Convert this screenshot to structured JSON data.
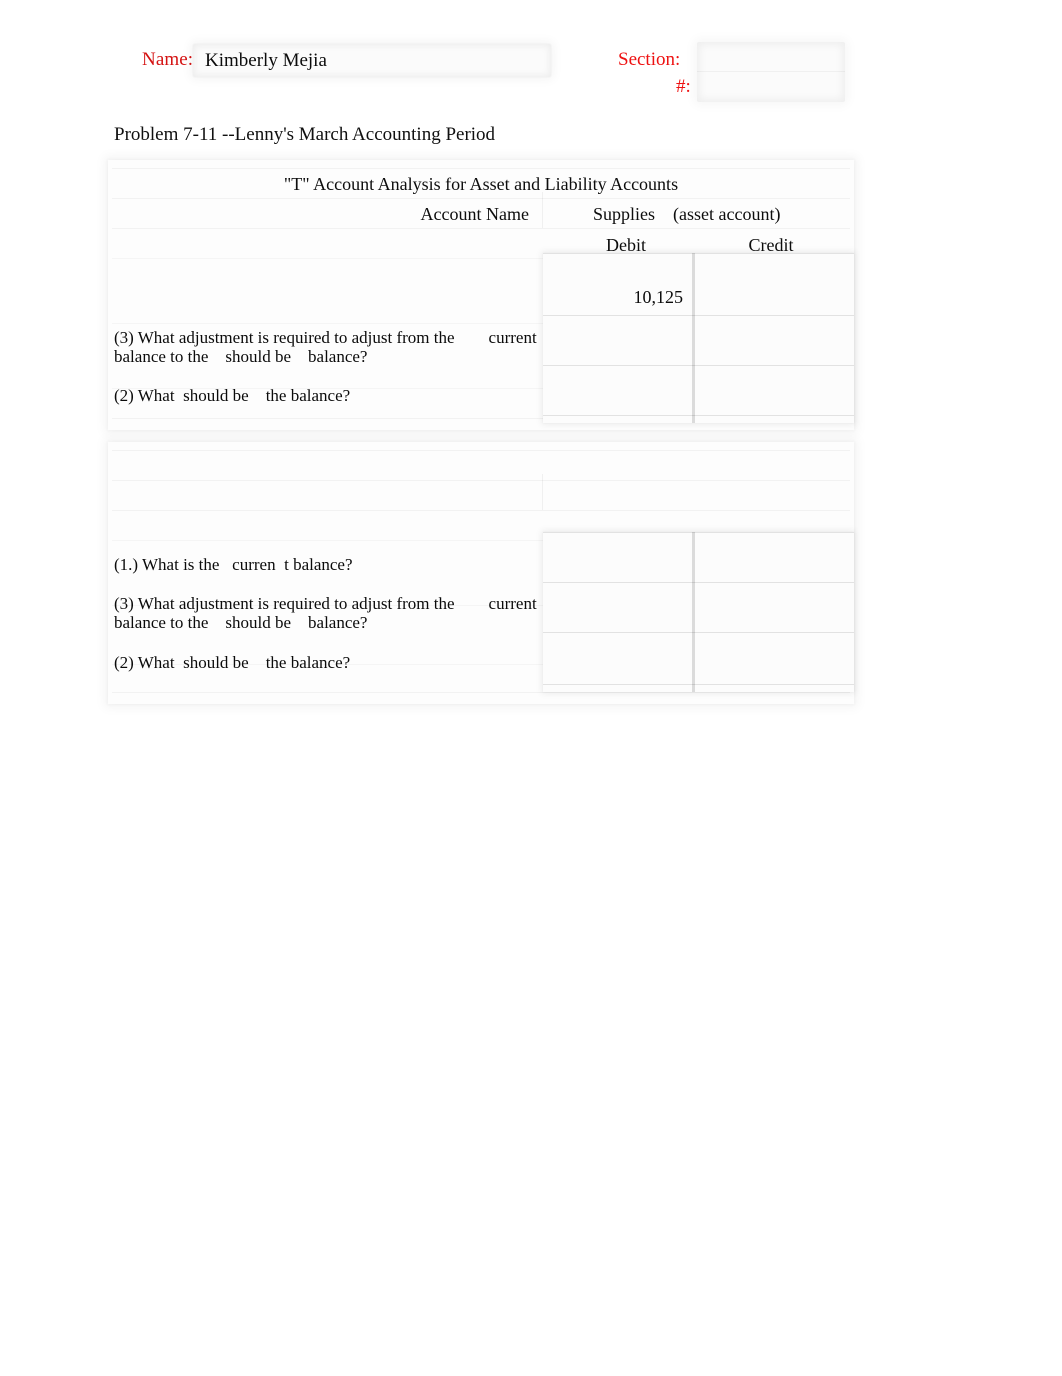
{
  "header": {
    "name_label": "Name:",
    "name_value": "Kimberly Mejia",
    "name_placeholder": "",
    "section_label": "Section:",
    "number_label": "#:",
    "section_value": "",
    "number_value": ""
  },
  "problem": {
    "title": "Problem 7-11 --Lenny's March Accounting Period"
  },
  "blocks": [
    {
      "heading": "\"T\" Account Analysis for Asset and Liability Accounts",
      "account_name_label": "Account Name",
      "account_name_value": "Supplies",
      "account_type": "(asset account)",
      "debit_header": "Debit",
      "credit_header": "Credit",
      "ledger_rows": [
        {
          "debit": "10,125",
          "credit": ""
        },
        {
          "debit": "",
          "credit": ""
        },
        {
          "debit": "",
          "credit": ""
        }
      ],
      "questions": [
        "(3) What adjustment is required to adjust from the        current\nbalance to the    should be    balance?",
        "(2) What  should be    the balance?"
      ]
    },
    {
      "heading": "",
      "account_name_label": "",
      "account_name_value": "",
      "account_type": "",
      "debit_header": "",
      "credit_header": "",
      "ledger_rows": [
        {
          "debit": "",
          "credit": ""
        },
        {
          "debit": "",
          "credit": ""
        },
        {
          "debit": "",
          "credit": ""
        }
      ],
      "questions": [
        "(1.) What is the   curren  t balance?",
        "(3) What adjustment is required to adjust from the        current\nbalance to the    should be    balance?",
        "(2) What  should be    the balance?"
      ]
    }
  ],
  "colors": {
    "label_red": "#ee1111",
    "text_black": "#0c0c0c",
    "grid_gray": "#e4e4e4"
  }
}
